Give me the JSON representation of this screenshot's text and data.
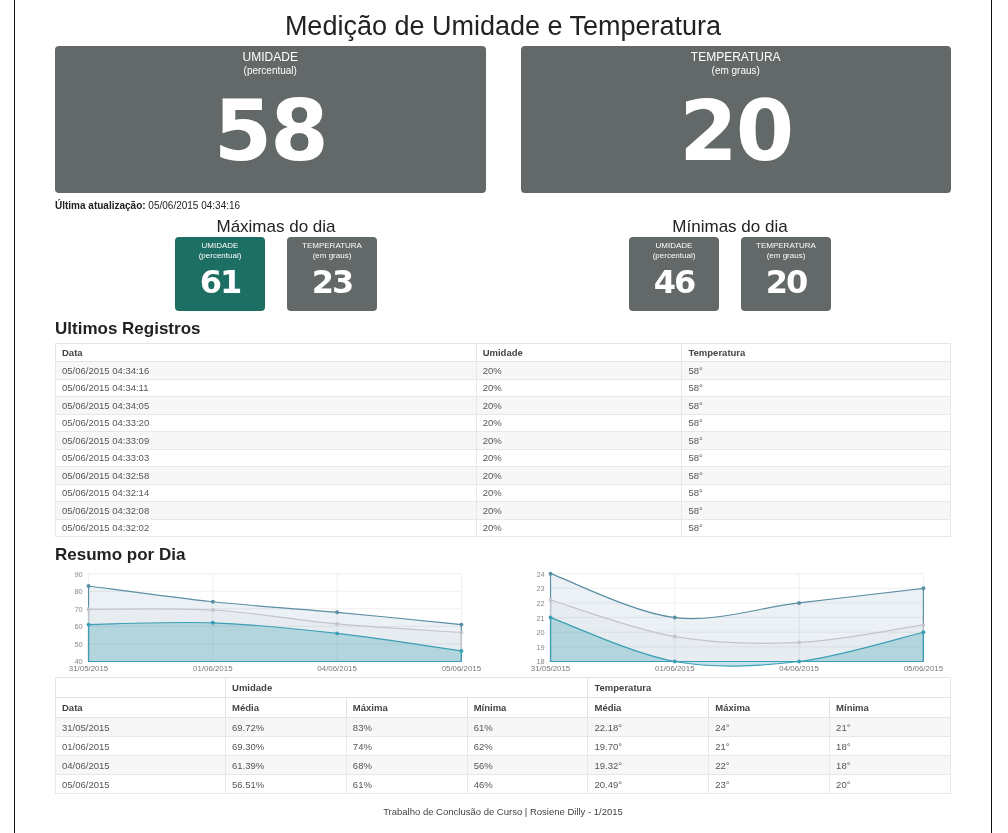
{
  "title": "Medição de Umidade e Temperatura",
  "cards": [
    {
      "label": "UMIDADE",
      "unit": "(percentual)",
      "value": "58"
    },
    {
      "label": "TEMPERATURA",
      "unit": "(em graus)",
      "value": "20"
    }
  ],
  "last_update": "**Última atualização:** 05/06/2015 04:34:16",
  "daily_groups": [
    {
      "title": "Máximas do dia",
      "cards": [
        {
          "label": "UMIDADE",
          "unit": "(percentual)",
          "value": "61",
          "color": "#1d6e63"
        },
        {
          "label": "TEMPERATURA",
          "unit": "(em graus)",
          "value": "23",
          "color": "#636868"
        }
      ]
    },
    {
      "title": "Mínimas do dia",
      "cards": [
        {
          "label": "UMIDADE",
          "unit": "(percentual)",
          "value": "46",
          "color": "#636868"
        },
        {
          "label": "TEMPERATURA",
          "unit": "(em graus)",
          "value": "20",
          "color": "#636868"
        }
      ]
    }
  ],
  "records": {
    "title": "Ultimos Registros",
    "columns": [
      "Data",
      "Umidade",
      "Temperatura"
    ],
    "rows": [
      [
        "05/06/2015 04:34:16",
        "20%",
        "58°"
      ],
      [
        "05/06/2015 04:34:11",
        "20%",
        "58°"
      ],
      [
        "05/06/2015 04:34:05",
        "20%",
        "58°"
      ],
      [
        "05/06/2015 04:33:20",
        "20%",
        "58°"
      ],
      [
        "05/06/2015 04:33:09",
        "20%",
        "58°"
      ],
      [
        "05/06/2015 04:33:03",
        "20%",
        "58°"
      ],
      [
        "05/06/2015 04:32:58",
        "20%",
        "58°"
      ],
      [
        "05/06/2015 04:32:14",
        "20%",
        "58°"
      ],
      [
        "05/06/2015 04:32:08",
        "20%",
        "58°"
      ],
      [
        "05/06/2015 04:32:02",
        "20%",
        "58°"
      ]
    ]
  },
  "summary": {
    "title": "Resumo por Dia",
    "charts": [
      {
        "chart_data": {
          "type": "area",
          "grid": true,
          "categories": [
            "31/05/2015",
            "01/06/2015",
            "04/06/2015",
            "05/06/2015"
          ],
          "ylim": [
            40,
            90
          ],
          "yticks": [
            40,
            50,
            60,
            70,
            80,
            90
          ],
          "series": [
            {
              "color": "#5b8fa3",
              "values": [
                83,
                74,
                68,
                61
              ]
            },
            {
              "color": "#c4c4cc",
              "values": [
                69.7,
                69.3,
                61.4,
                56.5
              ]
            },
            {
              "color": "#3a9fb5",
              "values": [
                61,
                62,
                56,
                46
              ]
            }
          ]
        }
      },
      {
        "chart_data": {
          "type": "area",
          "grid": true,
          "categories": [
            "31/05/2015",
            "01/06/2015",
            "04/06/2015",
            "05/06/2015"
          ],
          "ylim": [
            18,
            24
          ],
          "yticks": [
            18,
            19,
            20,
            21,
            22,
            23,
            24
          ],
          "series": [
            {
              "color": "#5b8fa3",
              "values": [
                24,
                21,
                22,
                23
              ]
            },
            {
              "color": "#c4c4cc",
              "values": [
                22.2,
                19.7,
                19.3,
                20.5
              ]
            },
            {
              "color": "#3a9fb5",
              "values": [
                21,
                18,
                18,
                20
              ]
            }
          ]
        }
      }
    ],
    "table": {
      "groups": [
        "Umidade",
        "Temperatura"
      ],
      "columns": [
        "Data",
        "Média",
        "Máxima",
        "Mínima",
        "Média",
        "Máxima",
        "Mínima"
      ],
      "rows": [
        [
          "31/05/2015",
          "69.72%",
          "83%",
          "61%",
          "22.18°",
          "24°",
          "21°"
        ],
        [
          "01/06/2015",
          "69.30%",
          "74%",
          "62%",
          "19.70°",
          "21°",
          "18°"
        ],
        [
          "04/06/2015",
          "61.39%",
          "68%",
          "56%",
          "19.32°",
          "22°",
          "18°"
        ],
        [
          "05/06/2015",
          "56.51%",
          "61%",
          "46%",
          "20.49°",
          "23°",
          "20°"
        ]
      ]
    }
  },
  "footer": "Trabalho de Conclusão de Curso | Rosiene Dilly - 1/2015"
}
